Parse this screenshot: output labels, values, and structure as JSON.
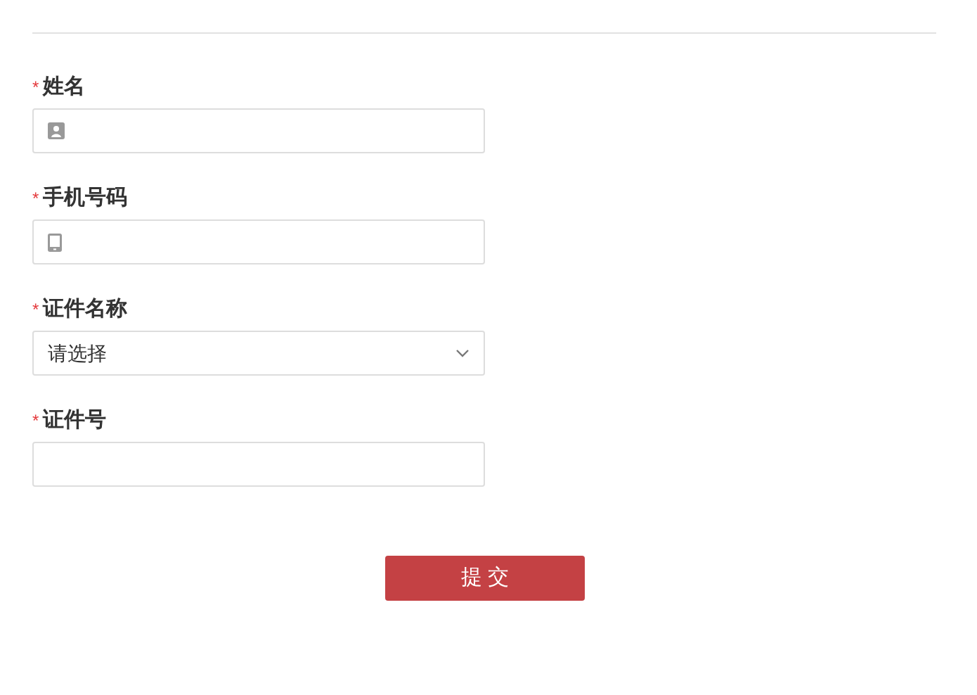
{
  "fields": [
    {
      "label": "姓名",
      "required_mark": "*",
      "kind": "person-input"
    },
    {
      "label": "手机号码",
      "required_mark": "*",
      "kind": "phone-input"
    },
    {
      "label": "证件名称",
      "required_mark": "*",
      "kind": "select",
      "value": "请选择"
    },
    {
      "label": "证件号",
      "required_mark": "*",
      "kind": "input"
    }
  ],
  "submit_button": "提 交"
}
